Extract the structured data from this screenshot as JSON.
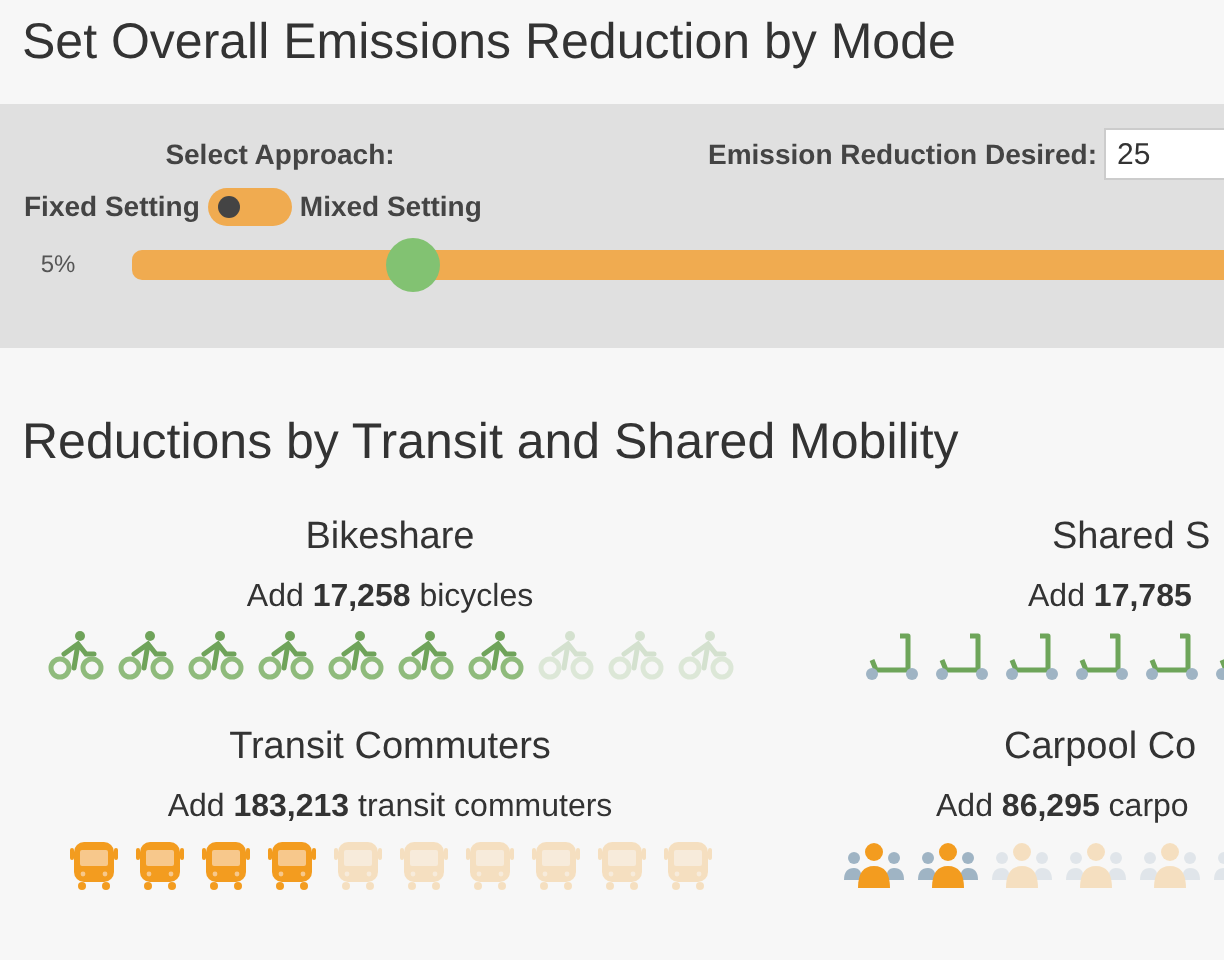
{
  "title": "Set Overall Emissions Reduction by Mode",
  "controls": {
    "approach_label": "Select Approach:",
    "left_option": "Fixed Setting",
    "right_option": "Mixed Setting",
    "mixed": false,
    "reduction_label": "Emission Reduction Desired:",
    "reduction_value": "25",
    "slider_min_label": "5%",
    "level": 0.23
  },
  "section_title": "Reductions by Transit and Shared Mobility",
  "modes": [
    {
      "kind": "bike",
      "name": "Bikeshare",
      "summary": "Add **17,258** bicycles",
      "icons": [
        {
          "filled": true
        },
        {
          "filled": true
        },
        {
          "filled": true
        },
        {
          "filled": true
        },
        {
          "filled": true
        },
        {
          "filled": true
        },
        {
          "filled": true
        },
        {
          "filled": false
        },
        {
          "filled": false
        },
        {
          "filled": false
        }
      ]
    },
    {
      "kind": "scooter",
      "name": "Shared S",
      "summary": "Add **17,785**",
      "icons": [
        {
          "filled": true
        },
        {
          "filled": true
        },
        {
          "filled": true
        },
        {
          "filled": true
        },
        {
          "filled": true
        },
        {
          "filled": true
        }
      ]
    },
    {
      "kind": "bus",
      "name": "Transit Commuters",
      "summary": "Add **183,213** transit commuters",
      "icons": [
        {
          "filled": true
        },
        {
          "filled": true
        },
        {
          "filled": true
        },
        {
          "filled": true
        },
        {
          "filled": false
        },
        {
          "filled": false
        },
        {
          "filled": false
        },
        {
          "filled": false
        },
        {
          "filled": false
        },
        {
          "filled": false
        }
      ]
    },
    {
      "kind": "carpool",
      "name": "Carpool Co",
      "summary": "Add **86,295** carpo",
      "icons": [
        {
          "filled": true
        },
        {
          "filled": true
        },
        {
          "filled": false
        },
        {
          "filled": false
        },
        {
          "filled": false
        },
        {
          "filled": false
        }
      ]
    }
  ]
}
